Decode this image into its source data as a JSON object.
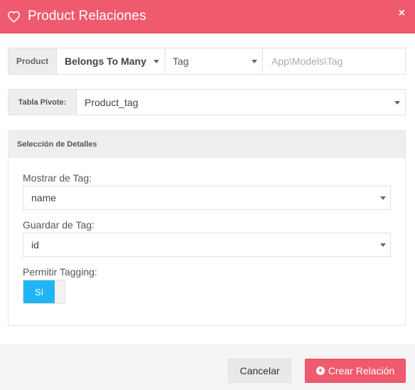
{
  "header": {
    "title": "Product Relaciones",
    "icon": "heart-icon",
    "close_label": "×",
    "color": "#f05a6e"
  },
  "relation_row": {
    "model_label": "Product",
    "relation_type": "Belongs To Many",
    "related_model": "Tag",
    "namespace_placeholder": "App\\Models\\Tag"
  },
  "pivot_row": {
    "label": "Tabla Pivote:",
    "value": "Product_tag"
  },
  "details": {
    "title": "Selección de Detalles",
    "show_label": "Mostrar de Tag:",
    "show_value": "name",
    "store_label": "Guardar de Tag:",
    "store_value": "id",
    "tagging_label": "Permitir Tagging:",
    "tagging_on_label": "Sí",
    "toggle_color": "#1fb5f2"
  },
  "footer": {
    "cancel_label": "Cancelar",
    "create_label": "Crear Relación"
  }
}
